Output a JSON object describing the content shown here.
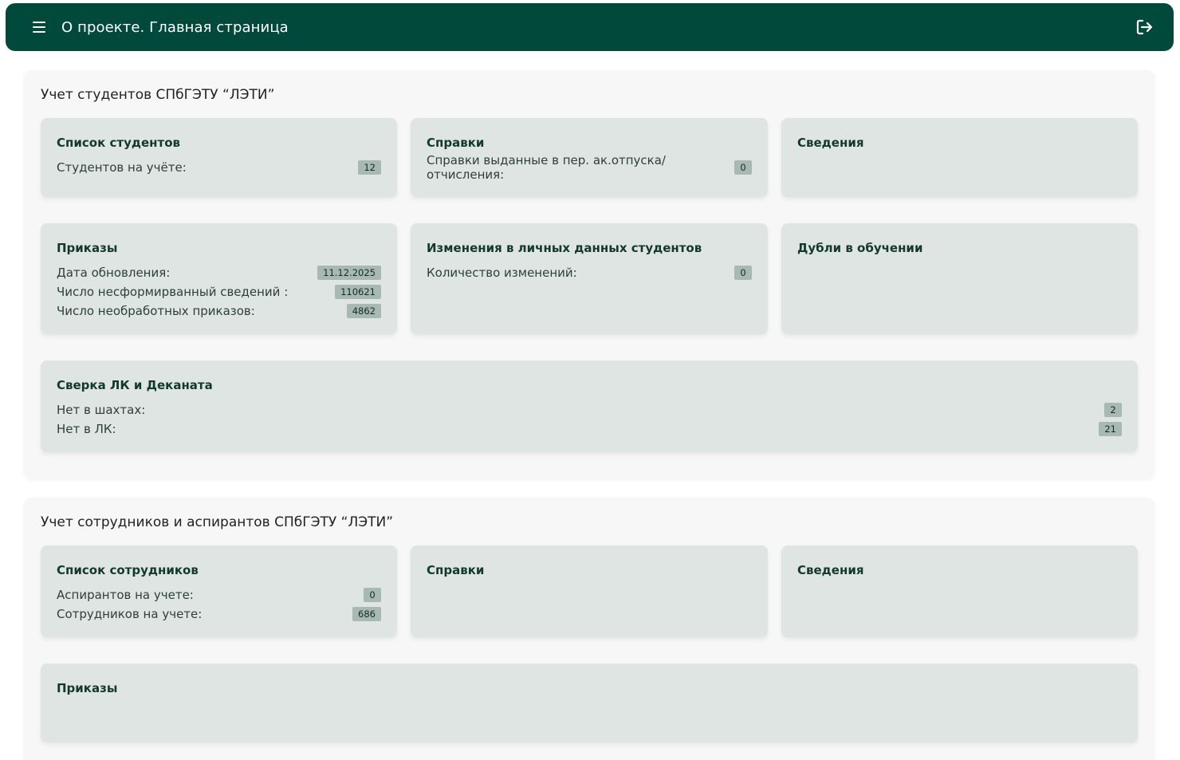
{
  "header": {
    "title": "О проекте. Главная страница"
  },
  "students": {
    "title": "Учет студентов СПбГЭТУ “ЛЭТИ”",
    "list": {
      "title": "Список студентов",
      "rows": [
        {
          "label": "Студентов на учёте:",
          "value": "12"
        }
      ]
    },
    "certificates": {
      "title": "Справки",
      "rows": [
        {
          "label": "Справки выданные в пер. ак.отпуска/отчисления:",
          "value": "0"
        }
      ]
    },
    "info": {
      "title": "Сведения"
    },
    "orders": {
      "title": "Приказы",
      "rows": [
        {
          "label": "Дата обновления:",
          "value": "11.12.2025"
        },
        {
          "label": "Число несформирванный сведений :",
          "value": "110621"
        },
        {
          "label": "Число необработных приказов:",
          "value": "4862"
        }
      ]
    },
    "changes": {
      "title": "Изменения в личных данных студентов",
      "rows": [
        {
          "label": "Количество изменений:",
          "value": "0"
        }
      ]
    },
    "duplicates": {
      "title": "Дубли в обучении"
    },
    "reconcile": {
      "title": "Сверка ЛК и Деканата",
      "rows": [
        {
          "label": "Нет в шахтах:",
          "value": "2"
        },
        {
          "label": "Нет в ЛК:",
          "value": "21"
        }
      ]
    }
  },
  "staff": {
    "title": "Учет сотрудников и аспирантов СПбГЭТУ “ЛЭТИ”",
    "list": {
      "title": "Список сотрудников",
      "rows": [
        {
          "label": "Аспирантов на учете:",
          "value": "0"
        },
        {
          "label": "Сотрудников на учете:",
          "value": "686"
        }
      ]
    },
    "certificates": {
      "title": "Справки"
    },
    "info": {
      "title": "Сведения"
    },
    "orders": {
      "title": "Приказы"
    }
  }
}
